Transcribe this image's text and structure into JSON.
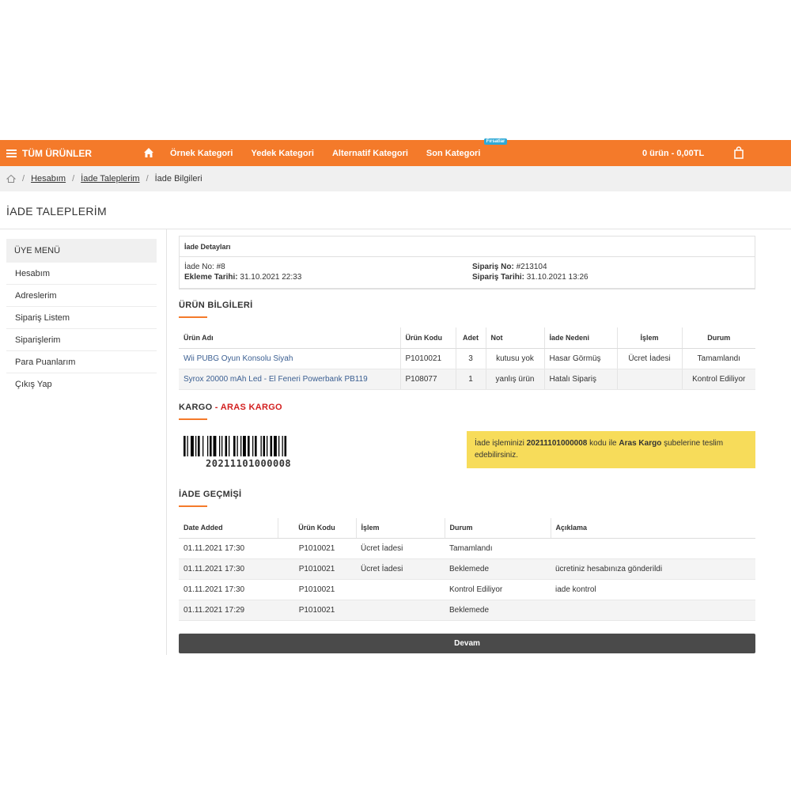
{
  "nav": {
    "all_products": "TÜM ÜRÜNLER",
    "links": [
      "Örnek Kategori",
      "Yedek Kategori",
      "Alternatif Kategori",
      "Son Kategori"
    ],
    "badge": "Fırsatlar",
    "cart_total": "0 ürün - 0,00TL",
    "accent_color": "#f47a2a"
  },
  "breadcrumb": {
    "items": [
      "Hesabım",
      "İade Taleplerim",
      "İade Bilgileri"
    ]
  },
  "page_title": "İADE TALEPLERİM",
  "sidebar": {
    "title": "ÜYE MENÜ",
    "items": [
      "Hesabım",
      "Adreslerim",
      "Sipariş Listem",
      "Siparişlerim",
      "Para Puanlarım",
      "Çıkış Yap"
    ]
  },
  "details": {
    "heading": "İade Detayları",
    "return_no_label": "İade No:",
    "return_no": "#8",
    "added_date_label": "Ekleme Tarihi:",
    "added_date": "31.10.2021 22:33",
    "order_no_label": "Sipariş No:",
    "order_no": "#213104",
    "order_date_label": "Sipariş Tarihi:",
    "order_date": "31.10.2021 13:26"
  },
  "products": {
    "title": "ÜRÜN BİLGİLERİ",
    "headers": [
      "Ürün Adı",
      "Ürün Kodu",
      "Adet",
      "Not",
      "İade Nedeni",
      "İşlem",
      "Durum"
    ],
    "rows": [
      [
        "Wii PUBG Oyun Konsolu Siyah",
        "P1010021",
        "3",
        "kutusu yok",
        "Hasar Görmüş",
        "Ücret İadesi",
        "Tamamlandı"
      ],
      [
        "Syrox 20000 mAh Led - El Feneri Powerbank PB119",
        "P108077",
        "1",
        "yanlış ürün",
        "Hatalı Sipariş",
        "",
        "Kontrol Ediliyor"
      ]
    ]
  },
  "cargo": {
    "label": "KARGO",
    "dash": " - ",
    "company": "ARAS KARGO",
    "barcode_number": "20211101000008",
    "note_prefix": "İade işleminizi ",
    "note_code": "20211101000008",
    "note_middle": " kodu ile ",
    "note_company": "Aras Kargo",
    "note_suffix": " şubelerine teslim edebilirsiniz.",
    "note_color": "#f7dc5a"
  },
  "history": {
    "title": "İADE GEÇMİŞİ",
    "headers": [
      "Date Added",
      "Ürün Kodu",
      "İşlem",
      "Durum",
      "Açıklama"
    ],
    "rows": [
      [
        "01.11.2021 17:30",
        "P1010021",
        "Ücret İadesi",
        "Tamamlandı",
        ""
      ],
      [
        "01.11.2021 17:30",
        "P1010021",
        "Ücret İadesi",
        "Beklemede",
        "ücretiniz hesabınıza gönderildi"
      ],
      [
        "01.11.2021 17:30",
        "P1010021",
        "",
        "Kontrol Ediliyor",
        "iade kontrol"
      ],
      [
        "01.11.2021 17:29",
        "P1010021",
        "",
        "Beklemede",
        ""
      ]
    ]
  },
  "continue_label": "Devam"
}
